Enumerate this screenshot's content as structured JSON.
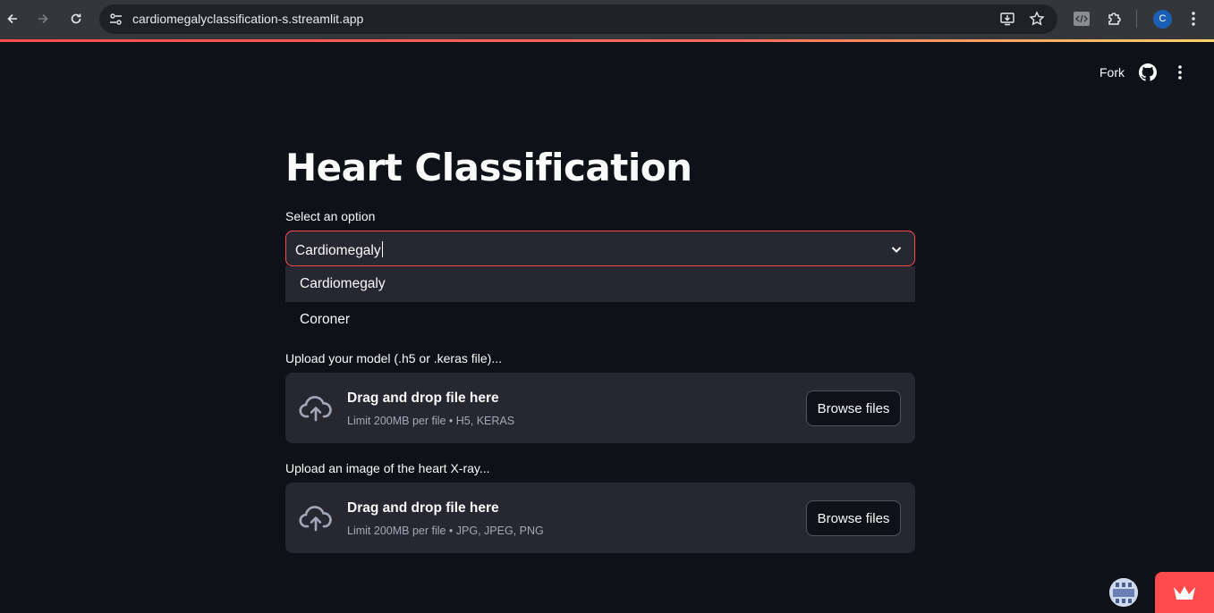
{
  "browser": {
    "url": "cardiomegalyclassification-s.streamlit.app",
    "profile_initial": "C"
  },
  "header": {
    "fork_label": "Fork"
  },
  "page": {
    "title": "Heart Classification"
  },
  "select": {
    "label": "Select an option",
    "value": "Cardiomegaly",
    "options": [
      "Cardiomegaly",
      "Coroner"
    ],
    "highlighted_option": "Cardiomegaly"
  },
  "model_uploader": {
    "label": "Upload your model (.h5 or .keras file)...",
    "drop_text": "Drag and drop file here",
    "limit_text": "Limit 200MB per file • H5, KERAS",
    "button_label": "Browse files"
  },
  "image_uploader": {
    "label": "Upload an image of the heart X-ray...",
    "drop_text": "Drag and drop file here",
    "limit_text": "Limit 200MB per file • JPG, JPEG, PNG",
    "button_label": "Browse files"
  },
  "colors": {
    "background": "#0e1117",
    "surface": "#262730",
    "accent": "#ff4b4b",
    "text": "#fafafa",
    "muted_text": "#a3a8b8"
  }
}
